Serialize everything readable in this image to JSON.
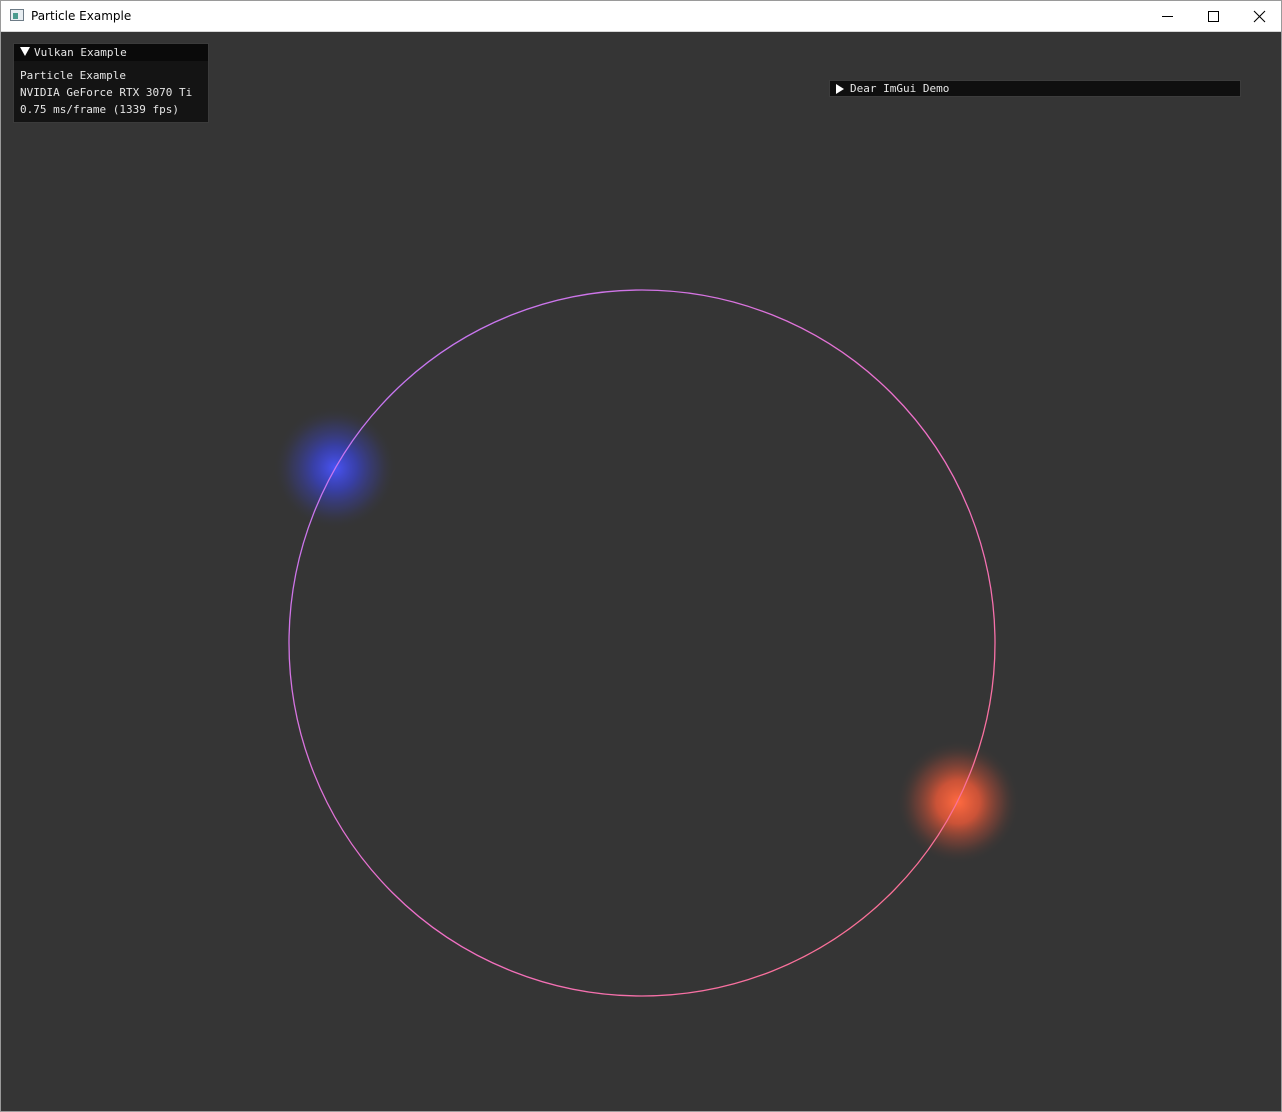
{
  "window": {
    "title": "Particle Example",
    "icon": "app-window-icon",
    "controls": [
      "minimize-icon",
      "maximize-icon",
      "close-icon"
    ]
  },
  "vulkan_panel": {
    "title": "Vulkan Example",
    "app_name": "Particle Example",
    "gpu": "NVIDIA GeForce RTX 3070 Ti",
    "frame_stats": "0.75 ms/frame (1339 fps)",
    "expanded": true
  },
  "demo_panel": {
    "title": "Dear ImGui Demo",
    "expanded": false
  },
  "scene": {
    "background": "#353535",
    "ring_color": "#e070d8",
    "particles": [
      {
        "name": "blue-particle",
        "color": "#3a44d8"
      },
      {
        "name": "orange-particle",
        "color": "#ff5a3a"
      }
    ]
  }
}
